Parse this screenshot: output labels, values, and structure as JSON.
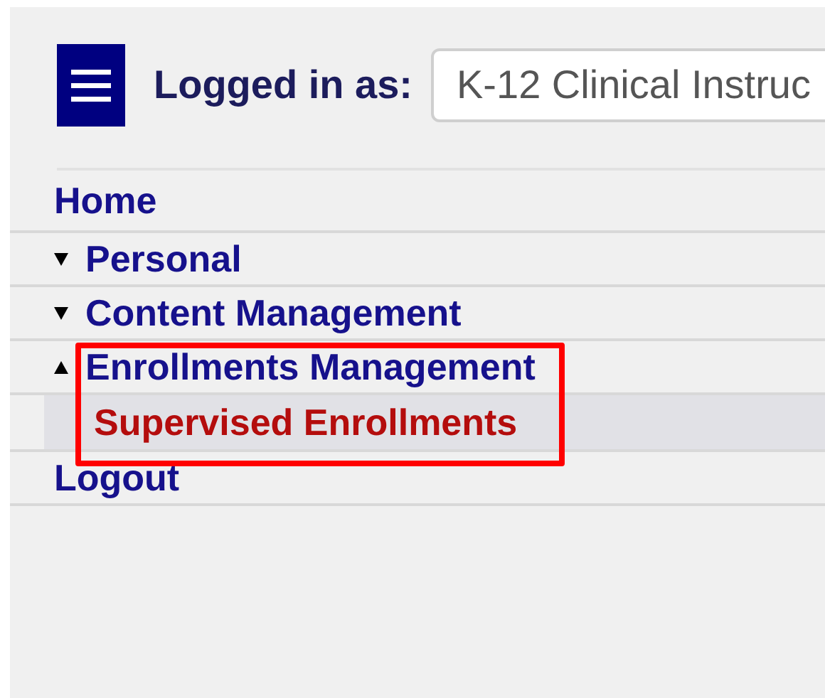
{
  "header": {
    "login_label": "Logged in as:",
    "role_field": {
      "value": "K-12 Clinical Instruc"
    }
  },
  "menu": {
    "items": [
      {
        "kind": "link",
        "label": "Home"
      },
      {
        "kind": "group",
        "label": "Personal",
        "expanded": false,
        "highlighted": false
      },
      {
        "kind": "group",
        "label": "Content Management",
        "expanded": false,
        "highlighted": false
      },
      {
        "kind": "group",
        "label": "Enrollments Management",
        "expanded": true,
        "highlighted": true,
        "children": [
          {
            "label": "Supervised Enrollments",
            "selected": true
          }
        ]
      },
      {
        "kind": "link",
        "label": "Logout"
      }
    ]
  }
}
